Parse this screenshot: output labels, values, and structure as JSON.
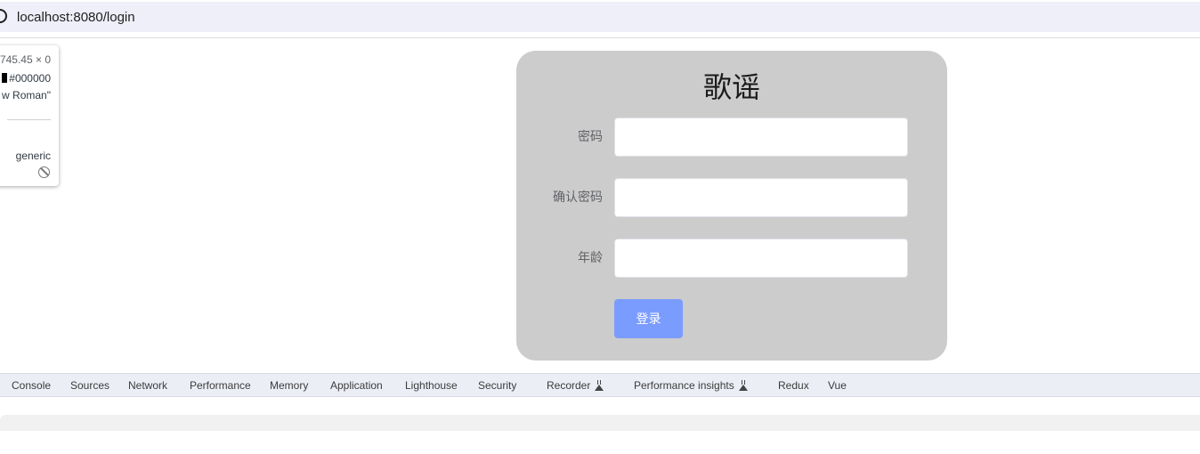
{
  "browser": {
    "url": "localhost:8080/login",
    "info_icon": "site-info-icon"
  },
  "inspect_tooltip": {
    "dimensions": "745.45 × 0",
    "color_value": "#000000",
    "color_swatch": "#000000",
    "font": "w Roman\"",
    "role": "generic",
    "not_allowed_icon": "not-allowed-icon"
  },
  "login_card": {
    "title": "歌谣",
    "fields": {
      "password": {
        "label": "密码",
        "value": "",
        "placeholder": ""
      },
      "confirm_password": {
        "label": "确认密码",
        "value": "",
        "placeholder": ""
      },
      "age": {
        "label": "年龄",
        "value": "",
        "placeholder": ""
      }
    },
    "submit_label": "登录",
    "colors": {
      "card_background": "#cccccc",
      "button_background": "#7b9cff"
    }
  },
  "devtools": {
    "tabs": [
      {
        "label": "Console"
      },
      {
        "label": "Sources"
      },
      {
        "label": "Network"
      },
      {
        "label": "Performance"
      },
      {
        "label": "Memory"
      },
      {
        "label": "Application"
      },
      {
        "label": "Lighthouse"
      },
      {
        "label": "Security"
      },
      {
        "label": "Recorder",
        "icon": "flask-icon"
      },
      {
        "label": "Performance insights",
        "icon": "flask-icon"
      },
      {
        "label": "Redux"
      },
      {
        "label": "Vue"
      }
    ]
  }
}
